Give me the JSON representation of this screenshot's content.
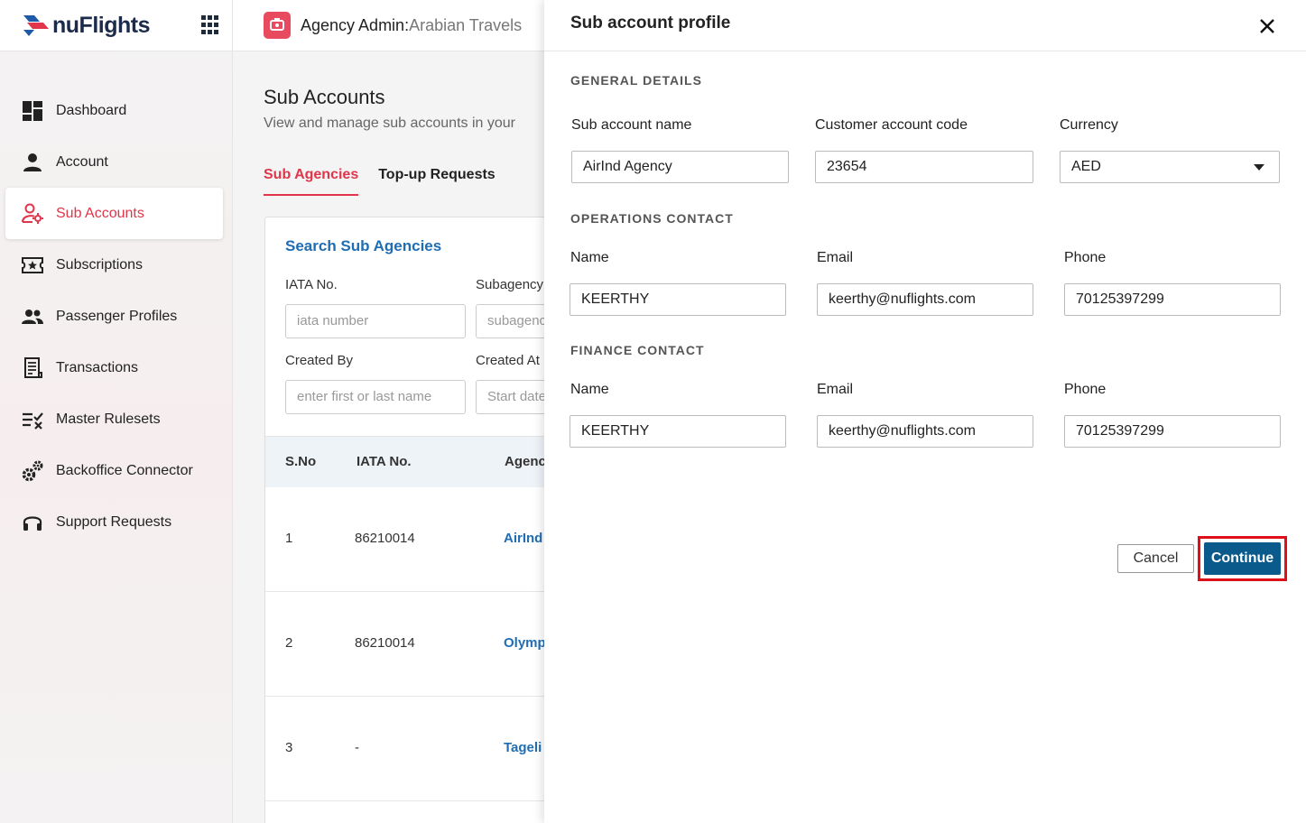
{
  "app": {
    "logo_text": "nuFlights",
    "agency_label": "Agency Admin",
    "separator": ":",
    "agency_name": "Arabian Travels"
  },
  "sidebar": {
    "items": [
      {
        "label": "Dashboard",
        "icon": "dashboard-icon",
        "active": false
      },
      {
        "label": "Account",
        "icon": "person-icon",
        "active": false
      },
      {
        "label": "Sub Accounts",
        "icon": "sub-accounts-icon",
        "active": true
      },
      {
        "label": "Subscriptions",
        "icon": "ticket-star-icon",
        "active": false
      },
      {
        "label": "Passenger Profiles",
        "icon": "people-icon",
        "active": false
      },
      {
        "label": "Transactions",
        "icon": "receipt-icon",
        "active": false
      },
      {
        "label": "Master Rulesets",
        "icon": "rules-icon",
        "active": false
      },
      {
        "label": "Backoffice Connector",
        "icon": "gears-icon",
        "active": false
      },
      {
        "label": "Support Requests",
        "icon": "headset-icon",
        "active": false
      }
    ]
  },
  "main": {
    "title": "Sub Accounts",
    "subtitle": "View and manage sub accounts in your",
    "tabs": [
      {
        "label": "Sub Agencies",
        "active": true
      },
      {
        "label": "Top-up Requests",
        "active": false
      }
    ],
    "search": {
      "title": "Search Sub Agencies",
      "iata_label": "IATA No.",
      "iata_placeholder": "iata number",
      "subagency_label": "Subagency",
      "subagency_placeholder": "subagenc",
      "created_by_label": "Created By",
      "created_by_placeholder": "enter first or last name",
      "created_at_label": "Created At",
      "created_at_placeholder": "Start date"
    },
    "table": {
      "headers": [
        "S.No",
        "IATA No.",
        "Agenc"
      ],
      "rows": [
        {
          "sno": "1",
          "iata": "86210014",
          "agency": "AirInd"
        },
        {
          "sno": "2",
          "iata": "86210014",
          "agency": "Olymp"
        },
        {
          "sno": "3",
          "iata": "-",
          "agency": "Tageli"
        }
      ]
    }
  },
  "drawer": {
    "title": "Sub account profile",
    "general": {
      "heading": "GENERAL DETAILS",
      "name_label": "Sub account name",
      "name_value": "AirInd Agency",
      "code_label": "Customer account code",
      "code_value": "23654",
      "currency_label": "Currency",
      "currency_value": "AED"
    },
    "operations": {
      "heading": "OPERATIONS CONTACT",
      "name_label": "Name",
      "name_value": "KEERTHY",
      "email_label": "Email",
      "email_value": "keerthy@nuflights.com",
      "phone_label": "Phone",
      "phone_value": "70125397299"
    },
    "finance": {
      "heading": "FINANCE CONTACT",
      "name_label": "Name",
      "name_value": "KEERTHY",
      "email_label": "Email",
      "email_value": "keerthy@nuflights.com",
      "phone_label": "Phone",
      "phone_value": "70125397299"
    },
    "cancel_label": "Cancel",
    "continue_label": "Continue"
  },
  "colors": {
    "accent_red": "#e0354a",
    "link_blue": "#1f6db3",
    "primary_button": "#0a5a8c",
    "highlight_border": "#e0101a"
  }
}
